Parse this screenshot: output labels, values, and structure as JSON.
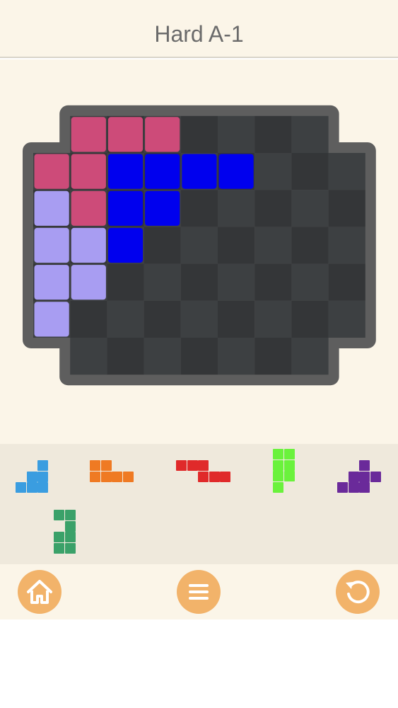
{
  "header": {
    "title": "Hard A-1"
  },
  "board": {
    "rows": 7,
    "cols": 9,
    "frame_color": "#5e5e5e",
    "dark_cell_color": "#343638",
    "light_cell_color": "#3d4042",
    "valid": [
      [
        0,
        1,
        1,
        1,
        1,
        1,
        1,
        1,
        0
      ],
      [
        1,
        1,
        1,
        1,
        1,
        1,
        1,
        1,
        1
      ],
      [
        1,
        1,
        1,
        1,
        1,
        1,
        1,
        1,
        1
      ],
      [
        1,
        1,
        1,
        1,
        1,
        1,
        1,
        1,
        1
      ],
      [
        1,
        1,
        1,
        1,
        1,
        1,
        1,
        1,
        1
      ],
      [
        1,
        1,
        1,
        1,
        1,
        1,
        1,
        1,
        1
      ],
      [
        0,
        1,
        1,
        1,
        1,
        1,
        1,
        1,
        0
      ]
    ],
    "placed": [
      {
        "name": "pink-piece",
        "color": "#cd4b79",
        "cells": [
          [
            0,
            1
          ],
          [
            0,
            2
          ],
          [
            0,
            3
          ],
          [
            1,
            0
          ],
          [
            1,
            1
          ],
          [
            2,
            1
          ]
        ]
      },
      {
        "name": "blue-piece",
        "color": "#0000ee",
        "cells": [
          [
            1,
            2
          ],
          [
            1,
            3
          ],
          [
            1,
            4
          ],
          [
            1,
            5
          ],
          [
            2,
            2
          ],
          [
            2,
            3
          ],
          [
            3,
            2
          ]
        ]
      },
      {
        "name": "lavender-piece",
        "color": "#a89df2",
        "cells": [
          [
            2,
            0
          ],
          [
            3,
            0
          ],
          [
            3,
            1
          ],
          [
            4,
            0
          ],
          [
            4,
            1
          ],
          [
            5,
            0
          ]
        ]
      }
    ]
  },
  "tray": {
    "pieces": [
      {
        "name": "tray-piece-sky-blue",
        "color": "#3a9de0",
        "cells": [
          [
            0,
            2
          ],
          [
            1,
            1
          ],
          [
            1,
            2
          ],
          [
            2,
            0
          ],
          [
            2,
            1
          ],
          [
            2,
            2
          ]
        ]
      },
      {
        "name": "tray-piece-orange",
        "color": "#ef7a23",
        "cells": [
          [
            0,
            0
          ],
          [
            0,
            1
          ],
          [
            1,
            0
          ],
          [
            1,
            1
          ],
          [
            1,
            2
          ],
          [
            1,
            3
          ]
        ]
      },
      {
        "name": "tray-piece-red",
        "color": "#e02a2a",
        "cells": [
          [
            0,
            0
          ],
          [
            0,
            1
          ],
          [
            0,
            2
          ],
          [
            1,
            2
          ],
          [
            1,
            3
          ],
          [
            1,
            4
          ]
        ]
      },
      {
        "name": "tray-piece-green",
        "color": "#6af23c",
        "cells": [
          [
            0,
            0
          ],
          [
            0,
            1
          ],
          [
            1,
            0
          ],
          [
            1,
            1
          ],
          [
            2,
            0
          ],
          [
            2,
            1
          ],
          [
            3,
            0
          ]
        ]
      },
      {
        "name": "tray-piece-purple",
        "color": "#6a2a9a",
        "cells": [
          [
            0,
            2
          ],
          [
            1,
            1
          ],
          [
            1,
            2
          ],
          [
            1,
            3
          ],
          [
            2,
            0
          ],
          [
            2,
            1
          ],
          [
            2,
            2
          ]
        ]
      },
      {
        "name": "tray-piece-dark-green",
        "color": "#3aa169",
        "cells": [
          [
            0,
            0
          ],
          [
            0,
            1
          ],
          [
            1,
            1
          ],
          [
            2,
            0
          ],
          [
            2,
            1
          ],
          [
            3,
            0
          ],
          [
            3,
            1
          ]
        ]
      }
    ]
  },
  "footer": {
    "accent_color": "#f2b36a",
    "buttons": [
      {
        "name": "home-button",
        "icon": "home-icon"
      },
      {
        "name": "menu-button",
        "icon": "menu-icon"
      },
      {
        "name": "restart-button",
        "icon": "restart-icon"
      }
    ]
  }
}
